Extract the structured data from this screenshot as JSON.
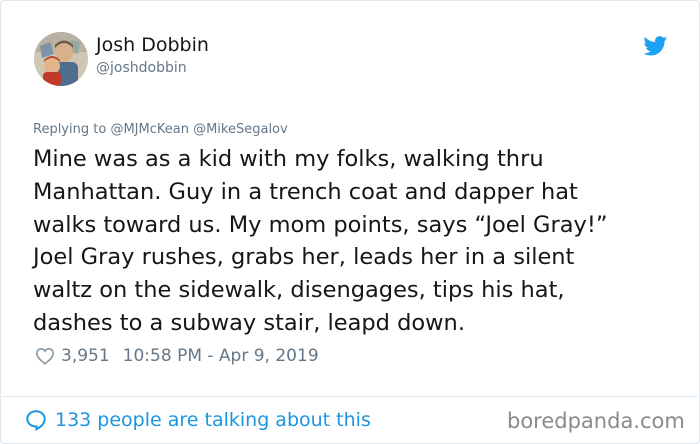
{
  "author": {
    "display_name": "Josh Dobbin",
    "handle": "@joshdobbin",
    "avatar_icon": "avatar-photo",
    "platform_icon": "twitter-bird-icon",
    "platform_color": "#1da1f2"
  },
  "reply": {
    "prefix": "Replying to",
    "mentions": [
      "@MJMcKean",
      "@MikeSegalov"
    ]
  },
  "tweet": {
    "lines": [
      "Mine was as a kid with my folks, walking thru",
      "Manhattan. Guy in a trench coat and dapper hat",
      "walks toward us. My mom points, says “Joel Gray!”",
      "Joel Gray rushes, grabs her, leads her in a silent",
      "waltz on the sidewalk, disengages, tips his hat,",
      "dashes to a subway stair, leapd down."
    ]
  },
  "meta": {
    "like_icon": "heart-icon",
    "likes": "3,951",
    "timestamp": "10:58 PM - Apr 9, 2019"
  },
  "footer": {
    "talk_icon": "speech-bubble-icon",
    "talk_text": "133 people are talking about this",
    "watermark": "boredpanda.com",
    "link_color": "#1b95e0"
  }
}
